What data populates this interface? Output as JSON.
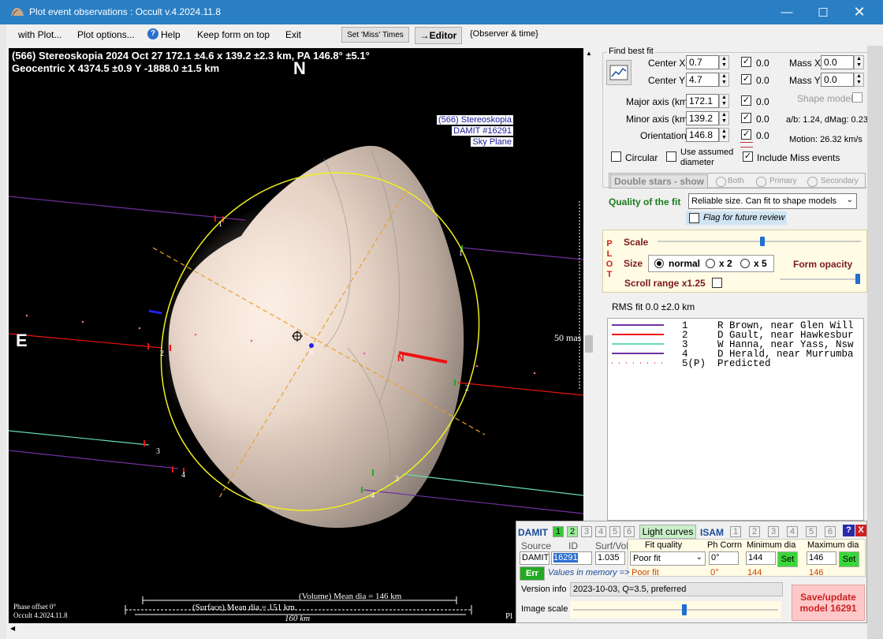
{
  "window": {
    "title": "Plot event observations : Occult v.4.2024.11.8"
  },
  "menu": {
    "with_plot": "with Plot...",
    "plot_options": "Plot options...",
    "help": "Help",
    "keep_on_top": "Keep form on top",
    "exit": "Exit",
    "set_miss": "Set 'Miss' Times",
    "editor": "→Editor",
    "observer_time": "{Observer & time}"
  },
  "plot": {
    "header1": "(566) Stereoskopia  2024 Oct 27  172.1 ±4.6 x 139.2 ±2.3 km,  PA 146.8° ±5.1°",
    "header2": "Geocentric  X  4374.5 ±0.9  Y -1888.0 ±1.5 km",
    "north": "N",
    "east": "E",
    "info1": "(566) Stereoskopia",
    "info2": "DAMIT #16291",
    "info3": "Sky Plane",
    "scale_mas": "50 mas",
    "phase": "Phase offset 0°",
    "occult_ver": "Occult 4.2024.11.8",
    "vol_dia": "(Volume) Mean dia = 146 km",
    "surf_dia": "(Surface) Mean dia = 151 km",
    "scale_km": "160 km",
    "pl": "Pl",
    "motion_n": "N",
    "chord_labels": [
      "1",
      "1",
      "2",
      "2",
      "3",
      "3",
      "4",
      "4",
      "3"
    ]
  },
  "fit": {
    "title": "Find best fit",
    "center_x_label": "Center X",
    "center_x": "0.7",
    "center_y_label": "Center Y",
    "center_y": "4.7",
    "major_label": "Major axis (km)",
    "major": "172.1",
    "minor_label": "Minor axis (km)",
    "minor": "139.2",
    "orient_label": "Orientation",
    "orient": "146.8",
    "zero_vals": [
      "0.0",
      "0.0",
      "0.0",
      "0.0",
      "0.0"
    ],
    "mass_x_label": "Mass X",
    "mass_x": "0.0",
    "mass_y_label": "Mass Y",
    "mass_y": "0.0",
    "shape_model": "Shape model",
    "ab": "a/b: 1.24, dMag: 0.23",
    "motion": "Motion: 26.32 km/s",
    "circular": "Circular",
    "use_assumed": "Use assumed",
    "diameter": "diameter",
    "include_miss": "Include Miss events",
    "double_stars": "Double stars - show",
    "both": "Both",
    "primary": "Primary",
    "secondary": "Secondary",
    "quality_label": "Quality of the fit",
    "quality_value": "Reliable size. Can fit to shape models",
    "flag_review": "Flag for future review"
  },
  "plotpanel": {
    "p_letters": [
      "P",
      "L",
      "O",
      "T"
    ],
    "scale": "Scale",
    "size": "Size",
    "normal": "normal",
    "x2": "x 2",
    "x5": "x 5",
    "form_opacity": "Form opacity",
    "scroll_range": "Scroll range x1.25",
    "rms": "RMS fit 0.0 ±2.0 km"
  },
  "legend": [
    {
      "line": "1     R Brown, near Glen Will",
      "color": "#7030a0"
    },
    {
      "line": "2     D Gault, near Hawkesbur",
      "color": "#ee1111"
    },
    {
      "line": "3     W Hanna, near Yass, Nsw",
      "color": "#66ddaa"
    },
    {
      "line": "4     D Herald, near Murrumba",
      "color": "#7030a0"
    },
    {
      "line": "5(P)  Predicted",
      "color": "#dd66aa"
    }
  ],
  "damit": {
    "damit_label": "DAMIT",
    "nums": [
      "1",
      "2",
      "3",
      "4",
      "5",
      "6"
    ],
    "light_curves": "Light curves",
    "isam": "ISAM",
    "help_q": "?",
    "close_x": "X",
    "source_h": "Source",
    "id_h": "ID",
    "surfvol_h": "Surf/Vol",
    "fitq_h": "Fit quality",
    "phcorr_h": "Ph Corrn",
    "mindia_h": "Minimum dia",
    "maxdia_h": "Maximum dia",
    "source": "DAMIT",
    "id": "16291",
    "surfvol": "1.035",
    "fit_quality": "Poor fit",
    "phcorr": "0°",
    "min_dia": "144",
    "max_dia": "146",
    "set": "Set",
    "err": "Err",
    "values_mem": "Values in memory =>",
    "mem_fit": "Poor fit",
    "mem_ph": "0°",
    "mem_min": "144",
    "mem_max": "146",
    "version_label": "Version info",
    "version": "2023-10-03, Q=3.5, preferred",
    "image_scale": "Image scale",
    "save": "Save/update",
    "save2": "model 16291"
  }
}
